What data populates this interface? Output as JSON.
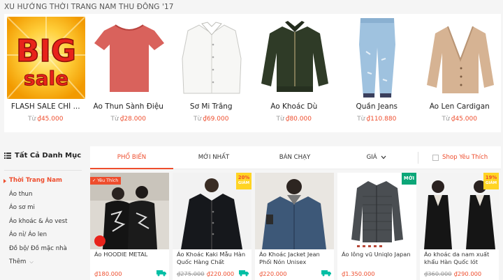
{
  "section": {
    "title": "XU HƯỚNG THỜI TRANG NAM THU ĐÔNG '17"
  },
  "top_products": [
    {
      "name": "FLASH SALE CHÍ ...",
      "from_label": "Từ",
      "price": "₫45.000",
      "image_text_1": "BIG",
      "image_text_2": "sale"
    },
    {
      "name": "Áo Thun Sành Điệu",
      "from_label": "Từ",
      "price": "₫28.000"
    },
    {
      "name": "Sơ Mi Trắng",
      "from_label": "Từ",
      "price": "₫69.000"
    },
    {
      "name": "Áo Khoác Dù",
      "from_label": "Từ",
      "price": "₫80.000"
    },
    {
      "name": "Quần Jeans",
      "from_label": "Từ",
      "price": "₫110.880"
    },
    {
      "name": "Áo Len Cardigan",
      "from_label": "Từ",
      "price": "₫45.000"
    }
  ],
  "sidebar": {
    "title": "Tất Cả Danh Mục",
    "items": [
      "Thời Trang Nam",
      "Áo thun",
      "Áo sơ mi",
      "Áo khoác & Áo vest",
      "Áo nỉ/ Áo len",
      "Đồ bộ/ Đồ mặc nhà",
      "Thêm"
    ]
  },
  "sort": {
    "tabs": [
      "PHỔ BIẾN",
      "MỚI NHẤT",
      "BÁN CHẠY",
      "GIÁ"
    ],
    "favorite_label": "Shop Yêu Thích"
  },
  "products": [
    {
      "name": "Áo HOODIE METAL",
      "old_price": "",
      "price": "₫180.000",
      "badge_fav": "✓ Yêu Thích"
    },
    {
      "name": "Áo Khoác Kaki Mẫu Hàn Quốc Hàng Chất Lượng...",
      "old_price": "₫275.000",
      "price": "₫220.000",
      "badge_sale": "20%",
      "badge_sale_sub": "GIẢM"
    },
    {
      "name": "Áo Khoác Jacket Jean Phối Nón Unisex",
      "old_price": "",
      "price": "₫220.000"
    },
    {
      "name": "Áo lông vũ Uniqlo Japan",
      "old_price": "",
      "price": "₫1.350.000",
      "badge_new": "MỚI"
    },
    {
      "name": "Áo khoác da nam xuất khẩu Hàn Quốc lót lông...",
      "old_price": "₫360.000",
      "price": "₫290.000",
      "badge_sale": "19%",
      "badge_sale_sub": "GIẢM"
    }
  ],
  "colors": {
    "accent": "#ee4d2d",
    "new_badge": "#0ca678",
    "sale_badge": "#ffd424",
    "free_ship": "#00bfa5"
  }
}
